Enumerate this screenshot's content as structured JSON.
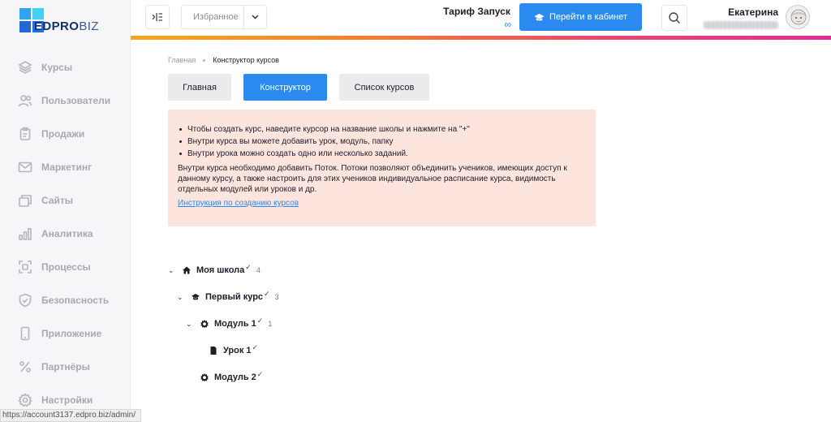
{
  "logo": {
    "part1": "EDPRO",
    "part2": "BIZ"
  },
  "sidebar": {
    "items": [
      {
        "label": "Курсы",
        "icon": "layers-icon"
      },
      {
        "label": "Пользователи",
        "icon": "users-icon"
      },
      {
        "label": "Продажи",
        "icon": "clipboard-icon"
      },
      {
        "label": "Маркетинг",
        "icon": "mail-icon"
      },
      {
        "label": "Сайты",
        "icon": "windows-icon"
      },
      {
        "label": "Аналитика",
        "icon": "bar-chart-icon"
      },
      {
        "label": "Процессы",
        "icon": "process-icon"
      },
      {
        "label": "Безопасность",
        "icon": "shield-icon"
      },
      {
        "label": "Приложение",
        "icon": "phone-icon"
      },
      {
        "label": "Партнёры",
        "icon": "percent-icon"
      },
      {
        "label": "Настройки",
        "icon": "gear-icon"
      }
    ]
  },
  "status_url": "https://account3137.edpro.biz/admin/",
  "topbar": {
    "favorites_label": "Избранное",
    "tariff_name": "Тариф Запуск",
    "tariff_value": "∞",
    "cabinet_button": "Перейти в кабинет",
    "user_name": "Екатерина"
  },
  "breadcrumb": {
    "home": "Главная",
    "current": "Конструктор курсов"
  },
  "tabs": [
    "Главная",
    "Конструктор",
    "Список курсов"
  ],
  "info": {
    "bullets": [
      "Чтобы создать курс, наведите курсор на название школы и нажмите на \"+\"",
      "Внутри курса вы можете добавить урок, модуль, папку",
      "Внутри урока можно создать одно или несколько заданий."
    ],
    "paragraph": "Внутри курса необходимо добавить Поток. Потоки позволяют объединить учеников, имеющих доступ к данному курсу, а также настроить для этих учеников индивидуальное расписание курса, видимость отдельных модулей или уроков и др.",
    "link": "Инструкция по созданию курсов"
  },
  "tree": {
    "school": {
      "label": "Моя школа",
      "count": "4"
    },
    "course": {
      "label": "Первый курс",
      "count": "3"
    },
    "module1": {
      "label": "Модуль 1",
      "count": "1"
    },
    "lesson1": {
      "label": "Урок 1"
    },
    "module2": {
      "label": "Модуль 2"
    },
    "check": "✓"
  },
  "colors": {
    "accent": "#2a8af0",
    "info_bg": "#fde4dc",
    "sidebar_bg": "#f6f6f8"
  }
}
